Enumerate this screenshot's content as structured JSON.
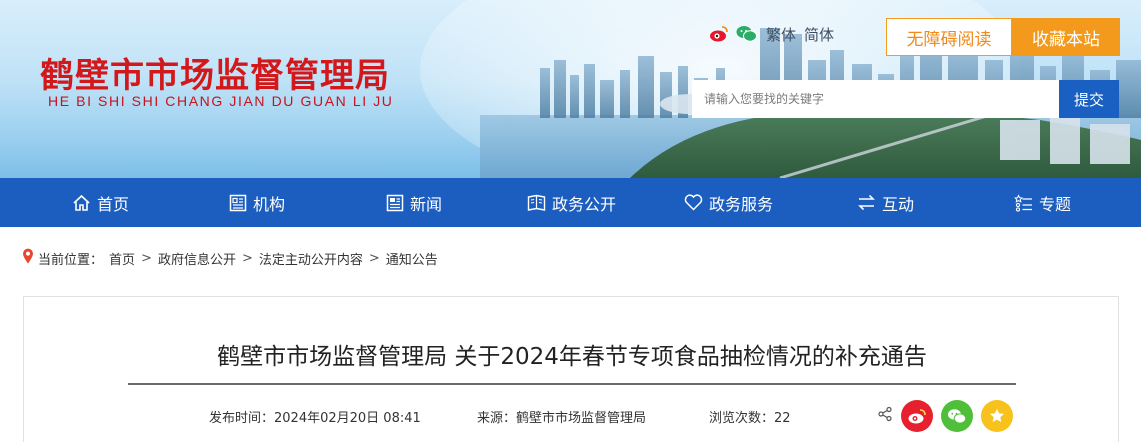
{
  "header": {
    "site_name": "鹤壁市市场监督管理局",
    "site_name_pinyin": "HE BI SHI SHI CHANG JIAN DU GUAN LI JU",
    "lang_traditional": "繁体",
    "lang_simplified": "简体",
    "accessibility_label": "无障碍阅读",
    "favorite_label": "收藏本站",
    "search_placeholder": "请输入您要找的关键字",
    "search_button": "提交",
    "colors": {
      "brand_red": "#d3181b",
      "nav_blue": "#1c5dc0",
      "accent_orange": "#f39a1c"
    }
  },
  "nav": {
    "items": [
      {
        "label": "首页",
        "icon": "home-icon"
      },
      {
        "label": "机构",
        "icon": "org-icon"
      },
      {
        "label": "新闻",
        "icon": "news-icon"
      },
      {
        "label": "政务公开",
        "icon": "open-gov-icon"
      },
      {
        "label": "政务服务",
        "icon": "heart-icon"
      },
      {
        "label": "互动",
        "icon": "exchange-icon"
      },
      {
        "label": "专题",
        "icon": "topic-list-icon"
      }
    ]
  },
  "breadcrumb": {
    "prefix": "当前位置：",
    "items": [
      "首页",
      "政府信息公开",
      "法定主动公开内容",
      "通知公告"
    ],
    "separator": ">"
  },
  "article": {
    "title": "鹤壁市市场监督管理局 关于2024年春节专项食品抽检情况的补充通告",
    "publish_time": "发布时间：2024年02月20日 08:41",
    "source": "来源：鹤壁市市场监督管理局",
    "views": "浏览次数：22"
  }
}
